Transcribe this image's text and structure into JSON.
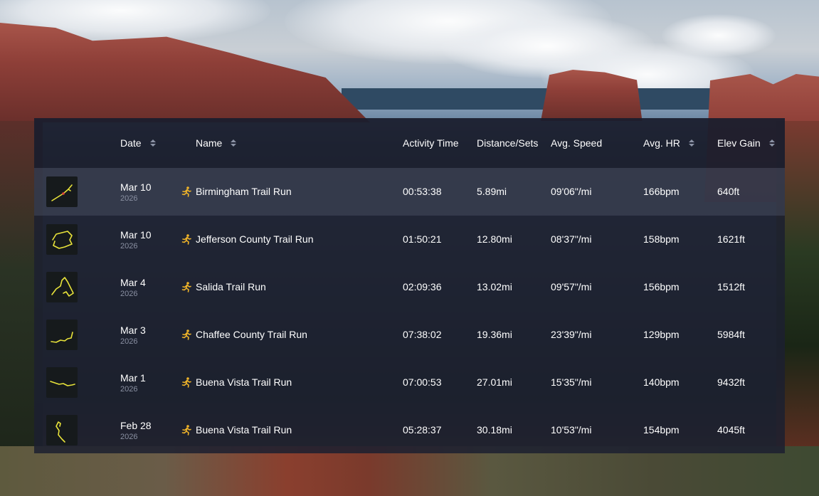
{
  "colors": {
    "accent": "#f0b429",
    "track": "#e8e33a",
    "muted": "#8a90a2",
    "text": "#ffffff"
  },
  "header": {
    "date": "Date",
    "name": "Name",
    "activity_time": "Activity Time",
    "distance": "Distance/Sets",
    "avg_speed": "Avg. Speed",
    "avg_hr": "Avg. HR",
    "elev_gain": "Elev Gain"
  },
  "rows": [
    {
      "date": "Mar 10",
      "year": "2026",
      "name": "Birmingham Trail Run",
      "time": "00:53:38",
      "distance": "5.89mi",
      "speed": "09'06\"/mi",
      "hr": "166bpm",
      "elev": "640ft",
      "icon": "running-icon"
    },
    {
      "date": "Mar 10",
      "year": "2026",
      "name": "Jefferson County Trail Run",
      "time": "01:50:21",
      "distance": "12.80mi",
      "speed": "08'37\"/mi",
      "hr": "158bpm",
      "elev": "1621ft",
      "icon": "running-icon"
    },
    {
      "date": "Mar 4",
      "year": "2026",
      "name": "Salida Trail Run",
      "time": "02:09:36",
      "distance": "13.02mi",
      "speed": "09'57\"/mi",
      "hr": "156bpm",
      "elev": "1512ft",
      "icon": "running-icon"
    },
    {
      "date": "Mar 3",
      "year": "2026",
      "name": "Chaffee County Trail Run",
      "time": "07:38:02",
      "distance": "19.36mi",
      "speed": "23'39\"/mi",
      "hr": "129bpm",
      "elev": "5984ft",
      "icon": "running-icon"
    },
    {
      "date": "Mar 1",
      "year": "2026",
      "name": "Buena Vista Trail Run",
      "time": "07:00:53",
      "distance": "27.01mi",
      "speed": "15'35\"/mi",
      "hr": "140bpm",
      "elev": "9432ft",
      "icon": "running-icon"
    },
    {
      "date": "Feb 28",
      "year": "2026",
      "name": "Buena Vista Trail Run",
      "time": "05:28:37",
      "distance": "30.18mi",
      "speed": "10'53\"/mi",
      "hr": "154bpm",
      "elev": "4045ft",
      "icon": "running-icon"
    }
  ]
}
